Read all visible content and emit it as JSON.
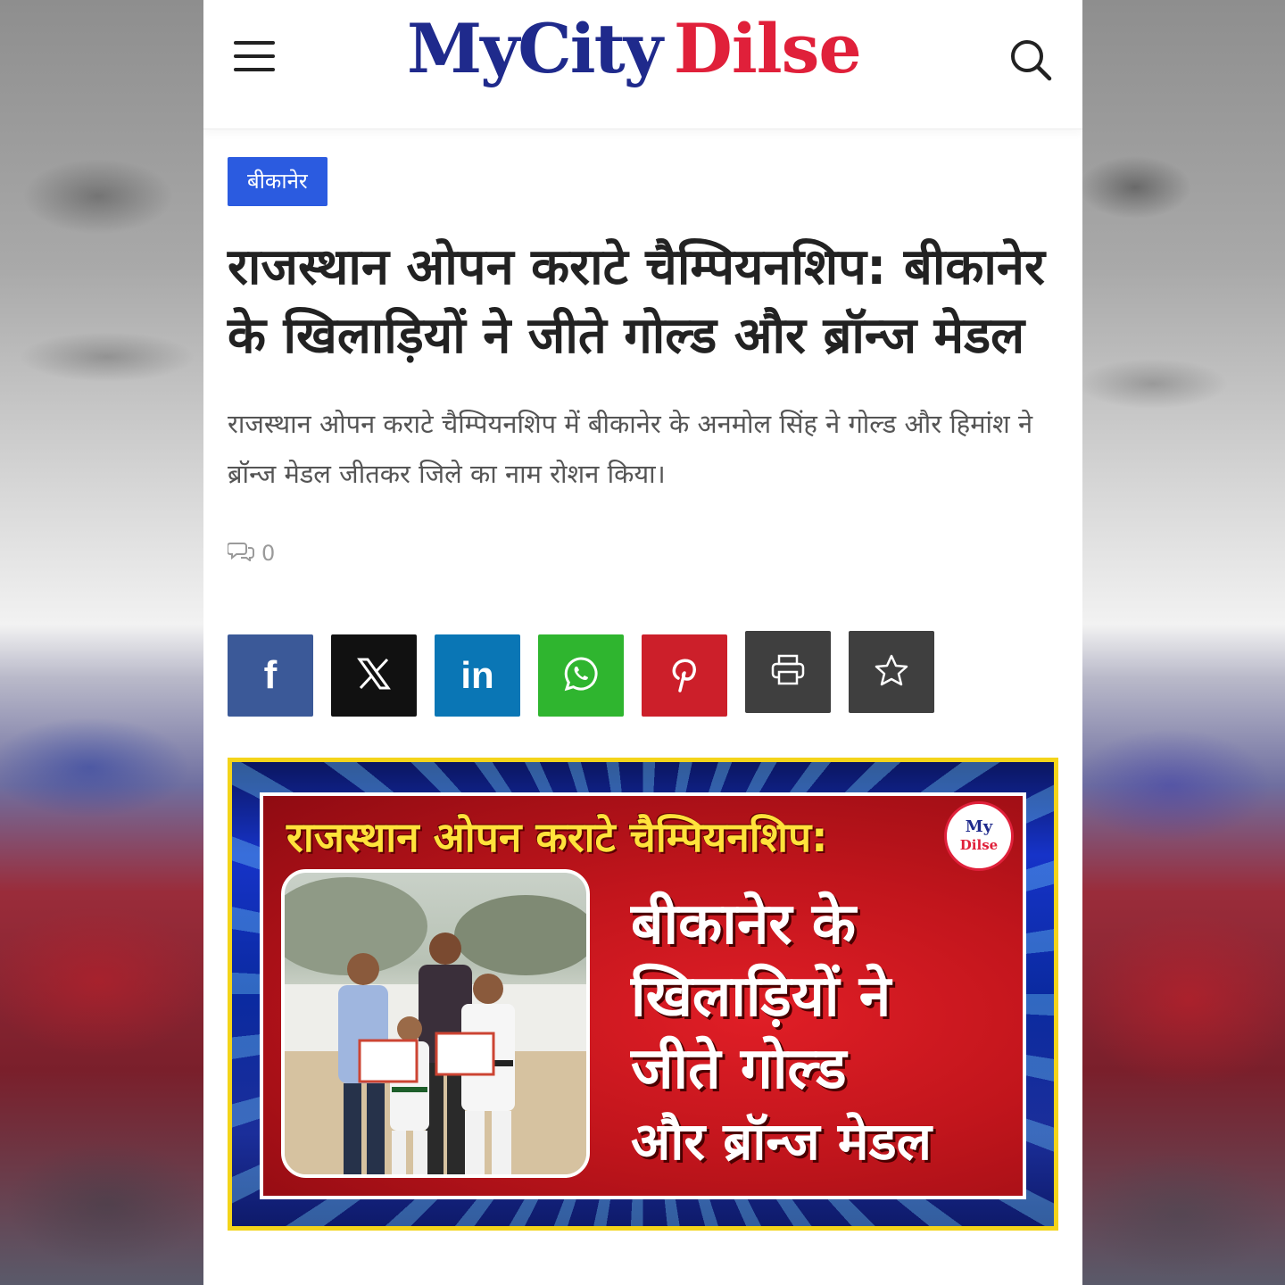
{
  "site": {
    "logo_part1": "MyCity",
    "logo_part2": "Dilse"
  },
  "article": {
    "category": "बीकानेर",
    "title": "राजस्थान ओपन कराटे चैम्पियनशिप: बीकानेर के खिलाड़ियों ने जीते गोल्ड और ब्रॉन्ज मेडल",
    "excerpt": "राजस्थान ओपन कराटे चैम्पियनशिप में बीकानेर के अनमोल सिंह ने गोल्ड और हिमांश ने ब्रॉन्ज मेडल जीतकर जिले का नाम रोशन किया।",
    "comment_count": "0"
  },
  "share_buttons": [
    {
      "network": "facebook",
      "icon": "facebook-icon",
      "color": "#3b5998"
    },
    {
      "network": "x",
      "icon": "x-icon",
      "color": "#111111"
    },
    {
      "network": "linkedin",
      "icon": "linkedin-icon",
      "color": "#0a76b5"
    },
    {
      "network": "whatsapp",
      "icon": "whatsapp-icon",
      "color": "#2fb52f"
    },
    {
      "network": "pinterest",
      "icon": "pinterest-icon",
      "color": "#cc1f2a"
    },
    {
      "network": "print",
      "icon": "printer-icon",
      "color": "#3f3f3f"
    },
    {
      "network": "bookmark",
      "icon": "star-icon",
      "color": "#3f3f3f"
    }
  ],
  "banner": {
    "headline": "राजस्थान ओपन कराटे चैम्पियनशिप:",
    "line1": "बीकानेर के",
    "line2": "खिलाड़ियों ने",
    "line3": "जीते गोल्ड",
    "line4": "और ब्रॉन्ज मेडल",
    "badge_part1": "My",
    "badge_part2": "Dilse"
  },
  "colors": {
    "brand_blue": "#1f2a8c",
    "brand_red": "#e0203a",
    "category_bg": "#2b5be0",
    "banner_border": "#f4d41a"
  }
}
